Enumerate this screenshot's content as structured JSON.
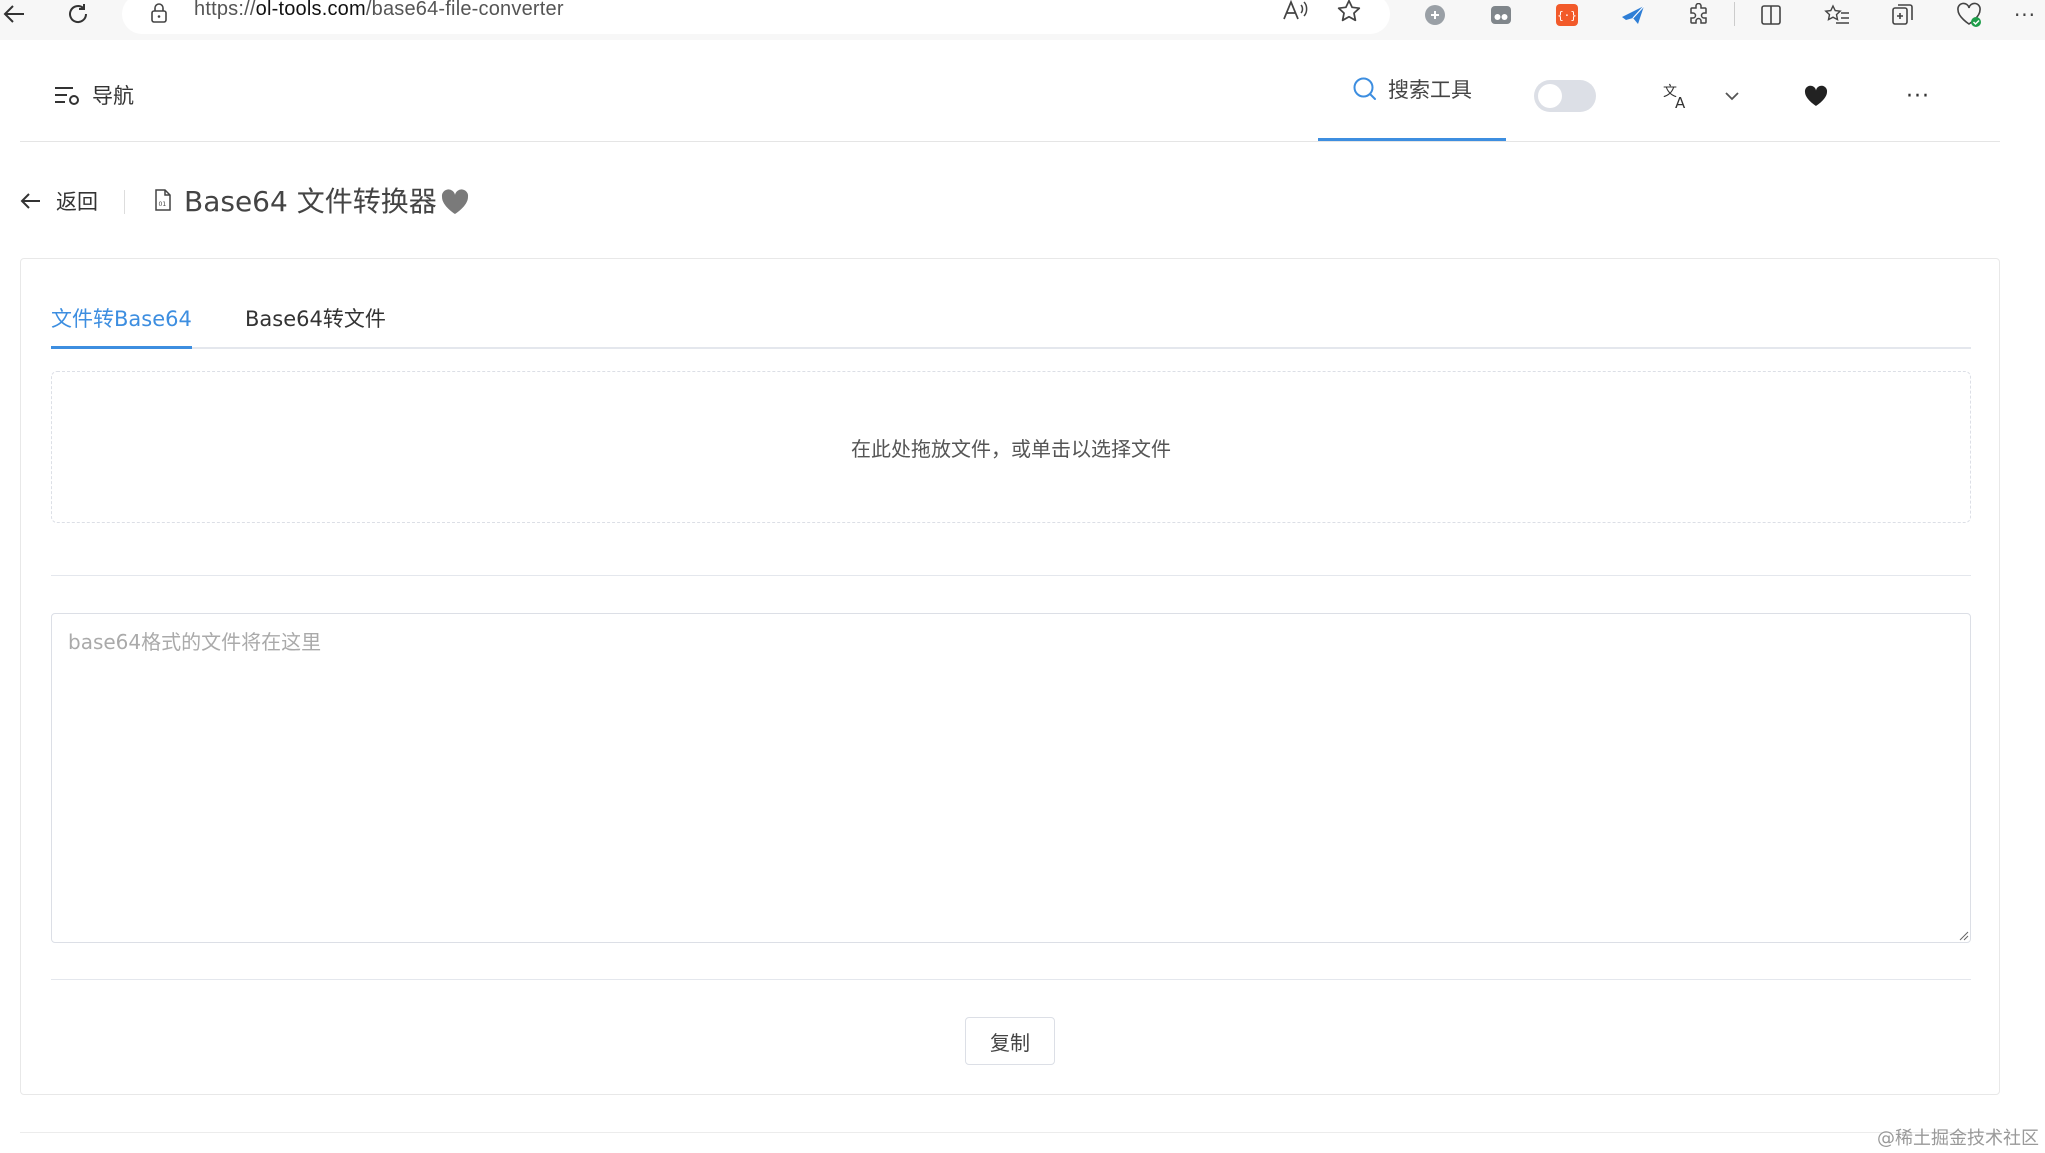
{
  "browser": {
    "url_prefix": "https://",
    "url_domain": "ol-tools.com",
    "url_path": "/base64-file-converter",
    "more_label": "···"
  },
  "header": {
    "nav_label": "导航",
    "search_label": "搜索工具",
    "more_label": "···"
  },
  "title_row": {
    "back_label": "返回",
    "page_title": "Base64 文件转换器"
  },
  "tabs": [
    {
      "label": "文件转Base64",
      "active": true
    },
    {
      "label": "Base64转文件",
      "active": false
    }
  ],
  "dropzone": {
    "text": "在此处拖放文件，或单击以选择文件"
  },
  "output": {
    "value": "",
    "placeholder": "base64格式的文件将在这里"
  },
  "copy_button": {
    "label": "复制"
  },
  "watermark": "@稀土掘金技术社区",
  "colors": {
    "accent": "#3d8ee0",
    "extension_red": "#f25a2a"
  }
}
